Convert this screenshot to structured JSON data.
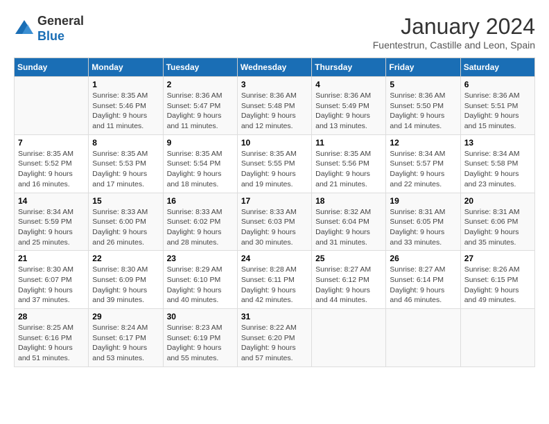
{
  "header": {
    "logo_line1": "General",
    "logo_line2": "Blue",
    "month": "January 2024",
    "location": "Fuentestrun, Castille and Leon, Spain"
  },
  "days_of_week": [
    "Sunday",
    "Monday",
    "Tuesday",
    "Wednesday",
    "Thursday",
    "Friday",
    "Saturday"
  ],
  "weeks": [
    [
      {
        "day": "",
        "info": ""
      },
      {
        "day": "1",
        "info": "Sunrise: 8:35 AM\nSunset: 5:46 PM\nDaylight: 9 hours\nand 11 minutes."
      },
      {
        "day": "2",
        "info": "Sunrise: 8:36 AM\nSunset: 5:47 PM\nDaylight: 9 hours\nand 11 minutes."
      },
      {
        "day": "3",
        "info": "Sunrise: 8:36 AM\nSunset: 5:48 PM\nDaylight: 9 hours\nand 12 minutes."
      },
      {
        "day": "4",
        "info": "Sunrise: 8:36 AM\nSunset: 5:49 PM\nDaylight: 9 hours\nand 13 minutes."
      },
      {
        "day": "5",
        "info": "Sunrise: 8:36 AM\nSunset: 5:50 PM\nDaylight: 9 hours\nand 14 minutes."
      },
      {
        "day": "6",
        "info": "Sunrise: 8:36 AM\nSunset: 5:51 PM\nDaylight: 9 hours\nand 15 minutes."
      }
    ],
    [
      {
        "day": "7",
        "info": "Sunrise: 8:35 AM\nSunset: 5:52 PM\nDaylight: 9 hours\nand 16 minutes."
      },
      {
        "day": "8",
        "info": "Sunrise: 8:35 AM\nSunset: 5:53 PM\nDaylight: 9 hours\nand 17 minutes."
      },
      {
        "day": "9",
        "info": "Sunrise: 8:35 AM\nSunset: 5:54 PM\nDaylight: 9 hours\nand 18 minutes."
      },
      {
        "day": "10",
        "info": "Sunrise: 8:35 AM\nSunset: 5:55 PM\nDaylight: 9 hours\nand 19 minutes."
      },
      {
        "day": "11",
        "info": "Sunrise: 8:35 AM\nSunset: 5:56 PM\nDaylight: 9 hours\nand 21 minutes."
      },
      {
        "day": "12",
        "info": "Sunrise: 8:34 AM\nSunset: 5:57 PM\nDaylight: 9 hours\nand 22 minutes."
      },
      {
        "day": "13",
        "info": "Sunrise: 8:34 AM\nSunset: 5:58 PM\nDaylight: 9 hours\nand 23 minutes."
      }
    ],
    [
      {
        "day": "14",
        "info": "Sunrise: 8:34 AM\nSunset: 5:59 PM\nDaylight: 9 hours\nand 25 minutes."
      },
      {
        "day": "15",
        "info": "Sunrise: 8:33 AM\nSunset: 6:00 PM\nDaylight: 9 hours\nand 26 minutes."
      },
      {
        "day": "16",
        "info": "Sunrise: 8:33 AM\nSunset: 6:02 PM\nDaylight: 9 hours\nand 28 minutes."
      },
      {
        "day": "17",
        "info": "Sunrise: 8:33 AM\nSunset: 6:03 PM\nDaylight: 9 hours\nand 30 minutes."
      },
      {
        "day": "18",
        "info": "Sunrise: 8:32 AM\nSunset: 6:04 PM\nDaylight: 9 hours\nand 31 minutes."
      },
      {
        "day": "19",
        "info": "Sunrise: 8:31 AM\nSunset: 6:05 PM\nDaylight: 9 hours\nand 33 minutes."
      },
      {
        "day": "20",
        "info": "Sunrise: 8:31 AM\nSunset: 6:06 PM\nDaylight: 9 hours\nand 35 minutes."
      }
    ],
    [
      {
        "day": "21",
        "info": "Sunrise: 8:30 AM\nSunset: 6:07 PM\nDaylight: 9 hours\nand 37 minutes."
      },
      {
        "day": "22",
        "info": "Sunrise: 8:30 AM\nSunset: 6:09 PM\nDaylight: 9 hours\nand 39 minutes."
      },
      {
        "day": "23",
        "info": "Sunrise: 8:29 AM\nSunset: 6:10 PM\nDaylight: 9 hours\nand 40 minutes."
      },
      {
        "day": "24",
        "info": "Sunrise: 8:28 AM\nSunset: 6:11 PM\nDaylight: 9 hours\nand 42 minutes."
      },
      {
        "day": "25",
        "info": "Sunrise: 8:27 AM\nSunset: 6:12 PM\nDaylight: 9 hours\nand 44 minutes."
      },
      {
        "day": "26",
        "info": "Sunrise: 8:27 AM\nSunset: 6:14 PM\nDaylight: 9 hours\nand 46 minutes."
      },
      {
        "day": "27",
        "info": "Sunrise: 8:26 AM\nSunset: 6:15 PM\nDaylight: 9 hours\nand 49 minutes."
      }
    ],
    [
      {
        "day": "28",
        "info": "Sunrise: 8:25 AM\nSunset: 6:16 PM\nDaylight: 9 hours\nand 51 minutes."
      },
      {
        "day": "29",
        "info": "Sunrise: 8:24 AM\nSunset: 6:17 PM\nDaylight: 9 hours\nand 53 minutes."
      },
      {
        "day": "30",
        "info": "Sunrise: 8:23 AM\nSunset: 6:19 PM\nDaylight: 9 hours\nand 55 minutes."
      },
      {
        "day": "31",
        "info": "Sunrise: 8:22 AM\nSunset: 6:20 PM\nDaylight: 9 hours\nand 57 minutes."
      },
      {
        "day": "",
        "info": ""
      },
      {
        "day": "",
        "info": ""
      },
      {
        "day": "",
        "info": ""
      }
    ]
  ]
}
